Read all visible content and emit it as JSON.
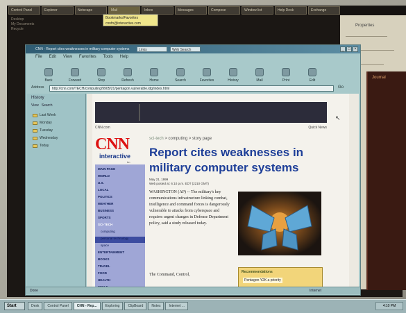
{
  "top_taskbar": {
    "tabs": [
      "Control Panel",
      "Explorer",
      "Netscape",
      "Mail",
      "Inbox",
      "Messages",
      "Compose",
      "Window list",
      "Help Desk",
      "Exchange"
    ],
    "active_tab_index": 3
  },
  "tooltip": {
    "line1": "Bookmarks/Favorites",
    "line2": "cnnfn@interactive.com"
  },
  "left_dark": {
    "lines": [
      "Desktop",
      "My Documents",
      "Recycle"
    ]
  },
  "right_panel": {
    "title": "Properties"
  },
  "right_dark_window": {
    "title": "Journal"
  },
  "browser": {
    "title": "CNN - Report cites weaknesses in military computer systems",
    "title_field_1": "Links",
    "title_field_2": "Web Search",
    "menu": [
      "File",
      "Edit",
      "View",
      "Favorites",
      "Tools",
      "Help"
    ],
    "toolbar": [
      {
        "label": "Back",
        "icon": "back-icon"
      },
      {
        "label": "Forward",
        "icon": "forward-icon"
      },
      {
        "label": "Stop",
        "icon": "stop-icon"
      },
      {
        "label": "Refresh",
        "icon": "refresh-icon"
      },
      {
        "label": "Home",
        "icon": "home-icon"
      },
      {
        "label": "Search",
        "icon": "search-icon"
      },
      {
        "label": "Favorites",
        "icon": "favorites-icon"
      },
      {
        "label": "History",
        "icon": "history-icon"
      },
      {
        "label": "Mail",
        "icon": "mail-icon"
      },
      {
        "label": "Print",
        "icon": "print-icon"
      },
      {
        "label": "Edit",
        "icon": "edit-icon"
      }
    ],
    "address_label": "Address",
    "address_value": "http://cnn.com/TECH/computing/9905/21/pentagon.vulnerable.idg/index.html",
    "go_label": "Go",
    "status_left": "Done",
    "status_right": "Internet"
  },
  "favorites": {
    "title": "History",
    "view_label": "View",
    "search_label": "Search",
    "items": [
      "Last Week",
      "Monday",
      "Tuesday",
      "Wednesday",
      "Today"
    ]
  },
  "page": {
    "links_left": "CNN.com",
    "links_right": "Quick News",
    "logo_text": "CNN",
    "logo_sub": "interactive",
    "logo_small": "tm",
    "breadcrumb_main": "sci-tech",
    "breadcrumb_rest": " > computing > story page",
    "headline": "Report cites weaknesses in military computer systems",
    "date_line1": "May 21, 1999",
    "date_line2": "Web posted at: 6:10 p.m. EDT (2210 GMT)",
    "body": "WASHINGTON (AP) -- The military's key communications infrastructure linking combat, intelligence and command forces is dangerously vulnerable to attacks from cyberspace and requires urgent changes in Defense Department policy, said a study released today.",
    "body_p2": "The Command, Control,",
    "nav_items": [
      "MAIN PAGE",
      "WORLD",
      "U.S.",
      "LOCAL",
      "POLITICS",
      "WEATHER",
      "BUSINESS",
      "SPORTS",
      "SCI-TECH",
      "computing",
      "personal technology",
      "space",
      "ENTERTAINMENT",
      "BOOKS",
      "TRAVEL",
      "FOOD",
      "HEALTH",
      "STYLE"
    ],
    "highlight_index": 8,
    "sidebar_title": "Recommendations",
    "sidebar_item": "Pentagon Y2K a priority"
  },
  "taskbar": {
    "start": "Start",
    "buttons": [
      "Desk",
      "Control Panel",
      "CNN - Rep...",
      "Exploring",
      "ClipBoard",
      "Notes",
      "Internet ..."
    ],
    "active_index": 2,
    "tray": "4:10 PM"
  }
}
